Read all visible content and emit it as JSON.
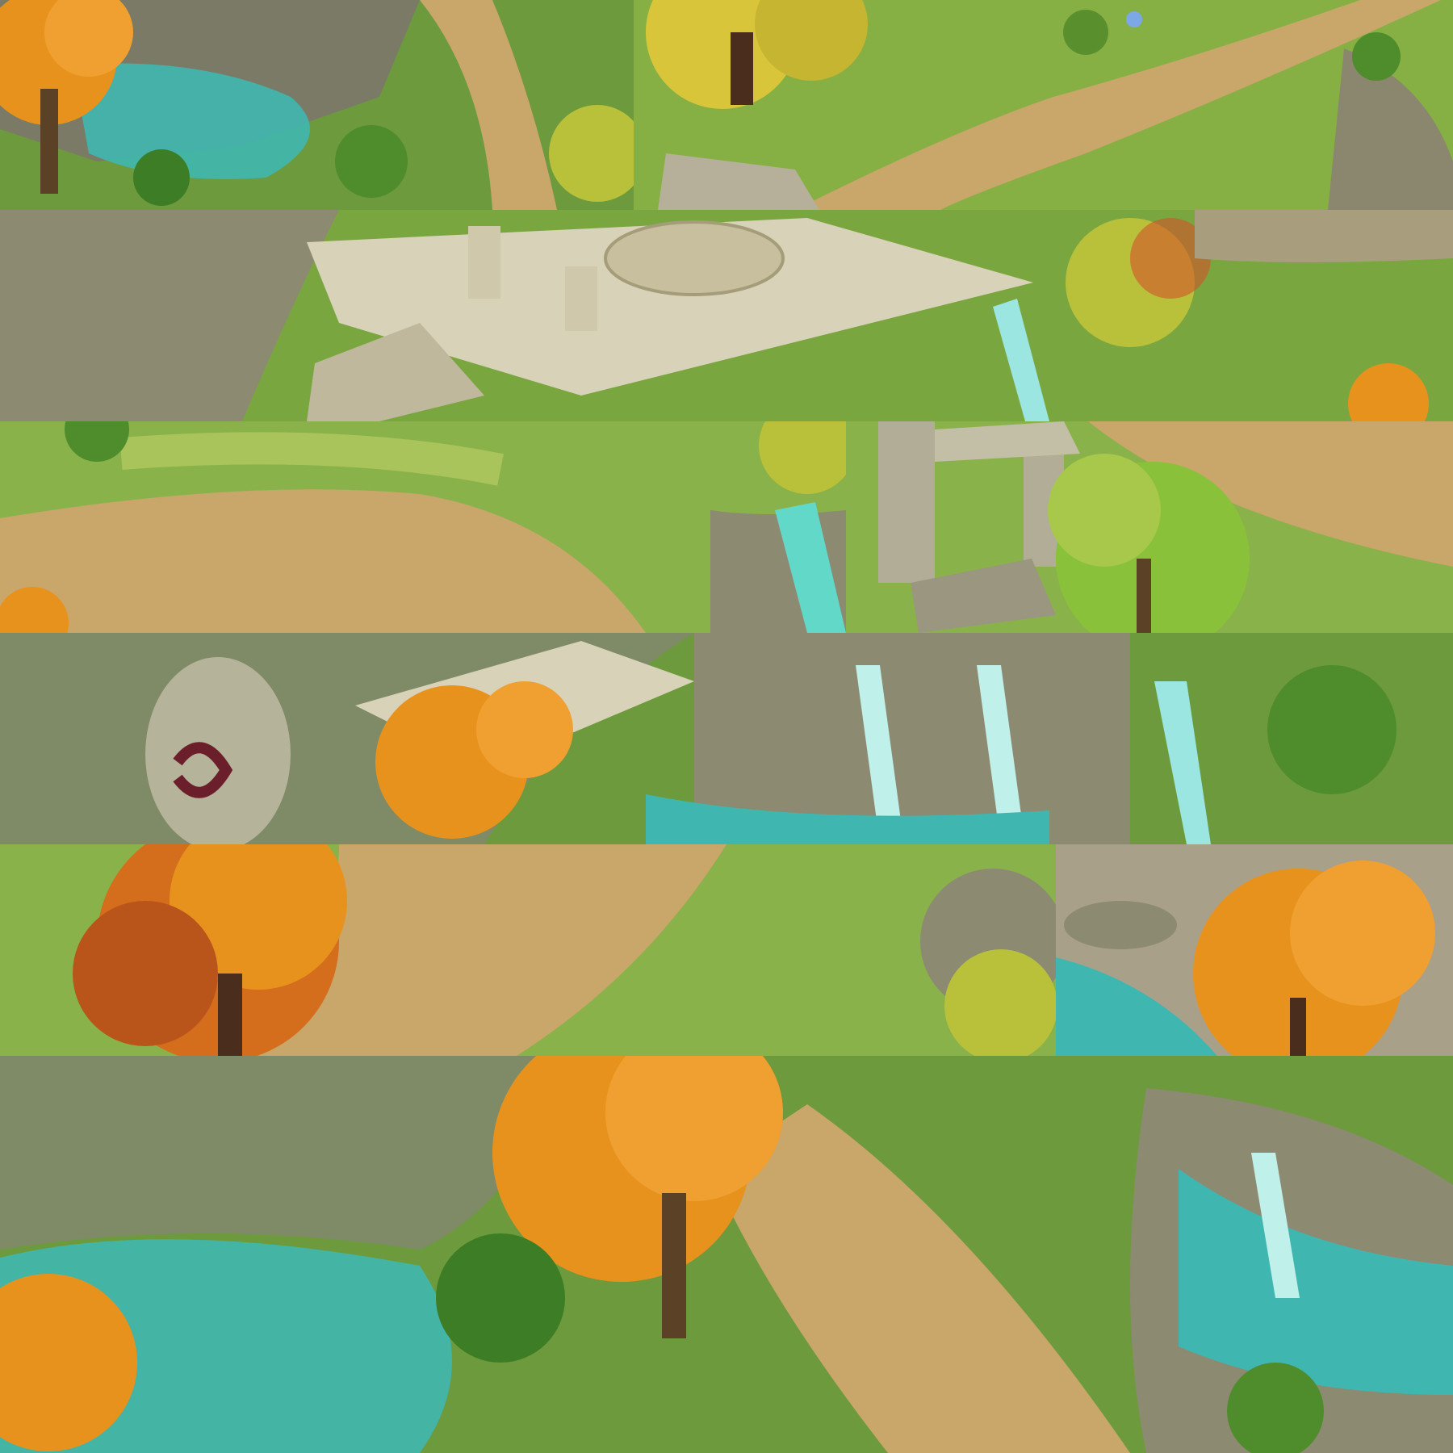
{
  "sprite_sheet": {
    "kind": "isometric fantasy map texture atlas",
    "tiles": [
      {
        "id": "tile-r1-a",
        "theme": "cliff-pond-autumn-tree"
      },
      {
        "id": "tile-r1-b",
        "theme": "path-yellow-tree-flowers"
      },
      {
        "id": "tile-r2-a",
        "theme": "stone-temple-plaza-waterfall"
      },
      {
        "id": "tile-r3-a",
        "theme": "grass-dirt-clearing-waterfall"
      },
      {
        "id": "tile-r3-b",
        "theme": "stone-gate-green-tree"
      },
      {
        "id": "tile-r4-a",
        "theme": "rune-stone-waterfalls"
      },
      {
        "id": "tile-r5-a",
        "theme": "large-autumn-tree-clearing"
      },
      {
        "id": "tile-r5-b",
        "theme": "pond-orange-tree"
      },
      {
        "id": "tile-r6-a",
        "theme": "misty-pond-autumn-trees-waterfall"
      }
    ]
  },
  "colors": {
    "grass": "#7aa640",
    "grass_light": "#a9c45a",
    "dirt": "#c9a66a",
    "rock": "#8d8a72",
    "stone_plaza": "#d8d2b8",
    "water": "#3fb7b0",
    "autumn_leaves": "#e8921e",
    "yellow_leaves": "#d8c53a"
  }
}
